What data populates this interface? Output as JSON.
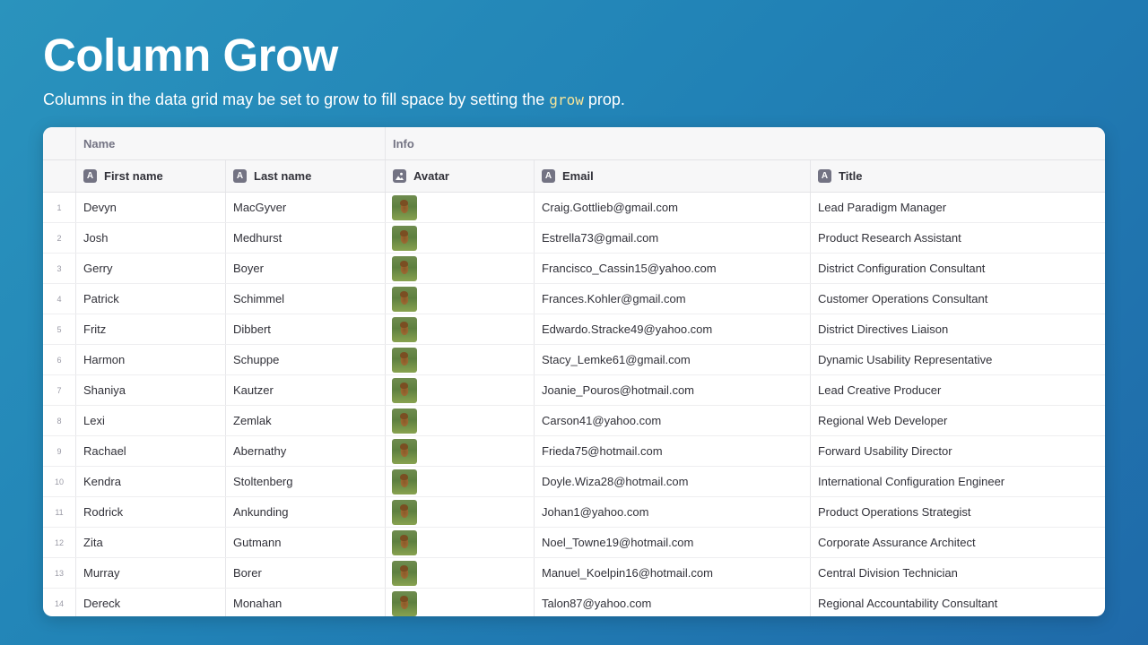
{
  "page": {
    "title": "Column Grow",
    "description_before": "Columns in the data grid may be set to grow to fill space by setting the ",
    "description_code": "grow",
    "description_after": " prop."
  },
  "grid": {
    "groups": {
      "name": "Name",
      "info": "Info"
    },
    "columns": {
      "first": "First name",
      "last": "Last name",
      "avatar": "Avatar",
      "email": "Email",
      "title": "Title"
    },
    "rows": [
      {
        "idx": "1",
        "first": "Devyn",
        "last": "MacGyver",
        "email": "Craig.Gottlieb@gmail.com",
        "title": "Lead Paradigm Manager"
      },
      {
        "idx": "2",
        "first": "Josh",
        "last": "Medhurst",
        "email": "Estrella73@gmail.com",
        "title": "Product Research Assistant"
      },
      {
        "idx": "3",
        "first": "Gerry",
        "last": "Boyer",
        "email": "Francisco_Cassin15@yahoo.com",
        "title": "District Configuration Consultant"
      },
      {
        "idx": "4",
        "first": "Patrick",
        "last": "Schimmel",
        "email": "Frances.Kohler@gmail.com",
        "title": "Customer Operations Consultant"
      },
      {
        "idx": "5",
        "first": "Fritz",
        "last": "Dibbert",
        "email": "Edwardo.Stracke49@yahoo.com",
        "title": "District Directives Liaison"
      },
      {
        "idx": "6",
        "first": "Harmon",
        "last": "Schuppe",
        "email": "Stacy_Lemke61@gmail.com",
        "title": "Dynamic Usability Representative"
      },
      {
        "idx": "7",
        "first": "Shaniya",
        "last": "Kautzer",
        "email": "Joanie_Pouros@hotmail.com",
        "title": "Lead Creative Producer"
      },
      {
        "idx": "8",
        "first": "Lexi",
        "last": "Zemlak",
        "email": "Carson41@yahoo.com",
        "title": "Regional Web Developer"
      },
      {
        "idx": "9",
        "first": "Rachael",
        "last": "Abernathy",
        "email": "Frieda75@hotmail.com",
        "title": "Forward Usability Director"
      },
      {
        "idx": "10",
        "first": "Kendra",
        "last": "Stoltenberg",
        "email": "Doyle.Wiza28@hotmail.com",
        "title": "International Configuration Engineer"
      },
      {
        "idx": "11",
        "first": "Rodrick",
        "last": "Ankunding",
        "email": "Johan1@yahoo.com",
        "title": "Product Operations Strategist"
      },
      {
        "idx": "12",
        "first": "Zita",
        "last": "Gutmann",
        "email": "Noel_Towne19@hotmail.com",
        "title": "Corporate Assurance Architect"
      },
      {
        "idx": "13",
        "first": "Murray",
        "last": "Borer",
        "email": "Manuel_Koelpin16@hotmail.com",
        "title": "Central Division Technician"
      },
      {
        "idx": "14",
        "first": "Dereck",
        "last": "Monahan",
        "email": "Talon87@yahoo.com",
        "title": "Regional Accountability Consultant"
      }
    ]
  },
  "colors": {
    "background_start": "#2a93bd",
    "background_end": "#1f6aa9",
    "code_text": "#f5e49a",
    "header_bg": "#f7f7f8",
    "icon_bg": "#737383"
  },
  "icons": {
    "text_column": "text-column-icon",
    "image_column": "image-column-icon"
  }
}
